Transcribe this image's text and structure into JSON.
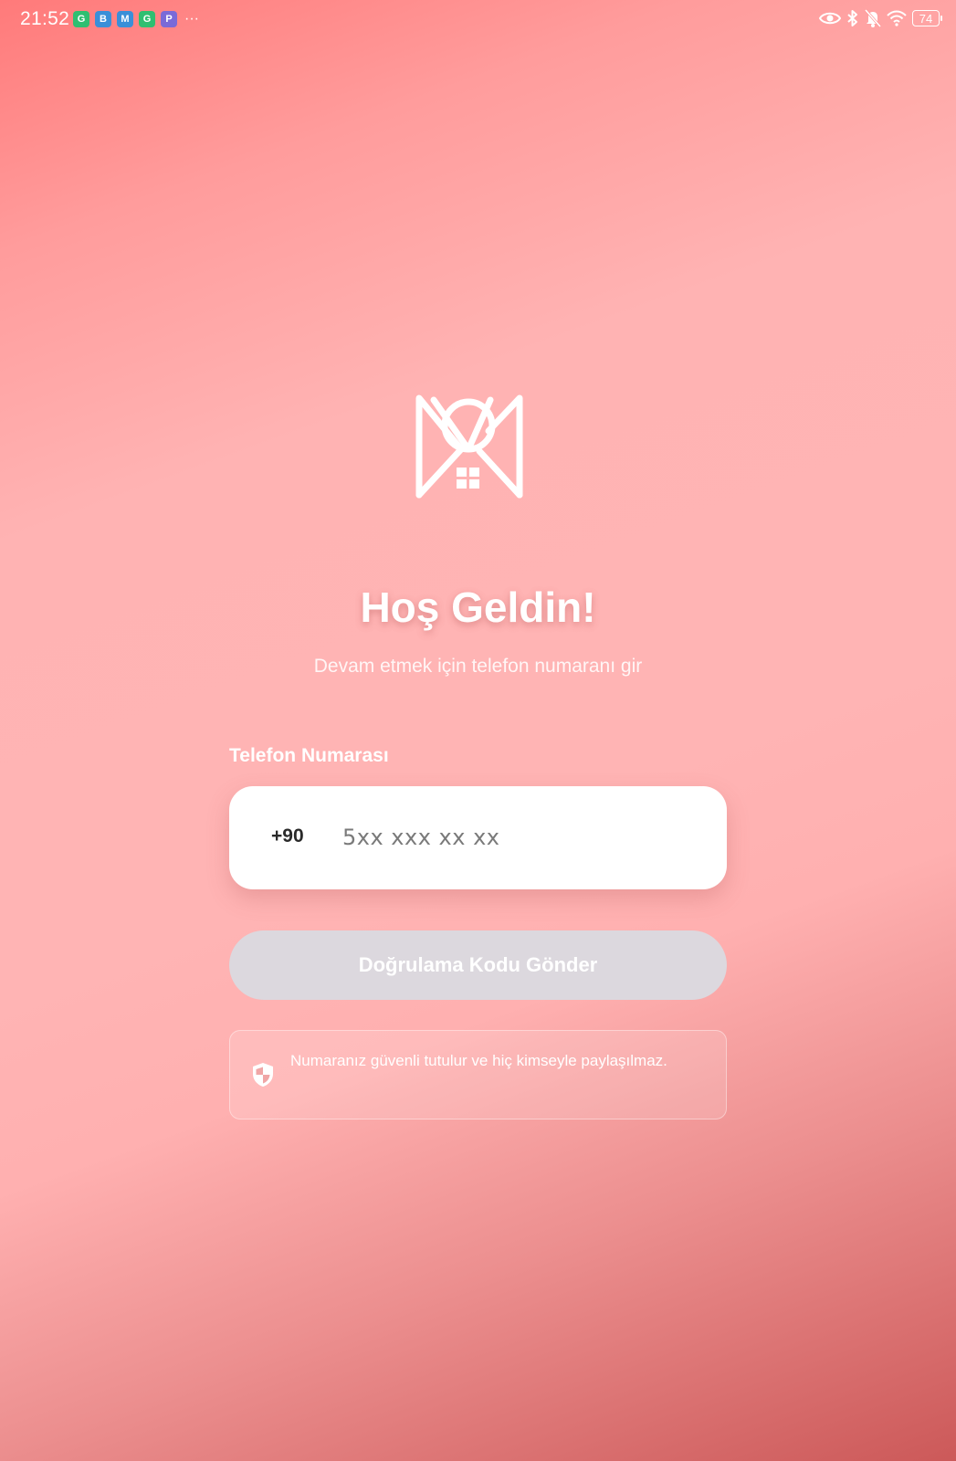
{
  "status_bar": {
    "time": "21:52",
    "battery": "74",
    "notification_icons": [
      "G",
      "B",
      "M",
      "G",
      "P"
    ]
  },
  "welcome": {
    "title": "Hoş Geldin!",
    "subtitle": "Devam etmek için telefon numaranı gir"
  },
  "phone": {
    "label": "Telefon Numarası",
    "country_code": "+90",
    "placeholder": "5xx xxx xx xx",
    "value": ""
  },
  "send_button": {
    "label": "Doğrulama Kodu Gönder"
  },
  "info": {
    "text": "Numaranız güvenli tutulur ve hiç kimseyle paylaşılmaz."
  },
  "icons": {
    "logo": "mr-house-logo-icon",
    "shield": "shield-icon"
  },
  "colors": {
    "background_light": "#ffb4b4",
    "background_dark": "#cc5959",
    "button_disabled": "#dcd8de"
  }
}
